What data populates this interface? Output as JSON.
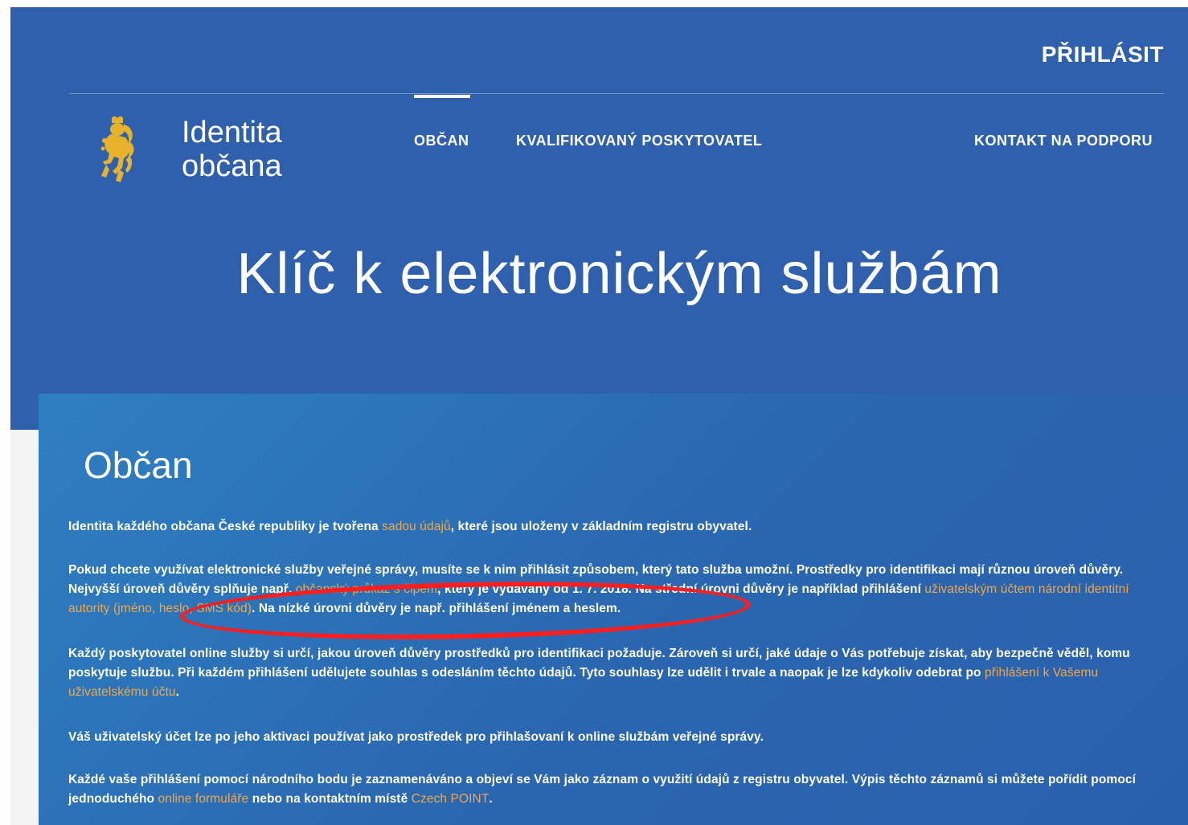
{
  "header": {
    "login_label": "PŘIHLÁSIT",
    "logo_line1": "Identita",
    "logo_line2": "občana",
    "nav": [
      {
        "label": "OBČAN",
        "active": true
      },
      {
        "label": "KVALIFIKOVANÝ POSKYTOVATEL",
        "active": false
      },
      {
        "label": "KONTAKT NA PODPORU",
        "active": false
      }
    ]
  },
  "hero": {
    "title": "Klíč k elektronickým službám"
  },
  "section": {
    "title": "Občan",
    "p1": {
      "before": "Identita každého občana České republiky je tvořena ",
      "link": "sadou údajů",
      "after": ", které jsou uloženy v základním registru obyvatel."
    },
    "p2": {
      "before": "Pokud chcete využívat elektronické služby veřejné správy, musíte se k nim přihlásit způsobem, který tato služba umožní. Prostředky pro identifikaci mají různou úroveň důvěry. Nejvyšší úroveň důvěry splňuje např. ",
      "link1": "občanský průkaz s čipem",
      "middle": ", který je vydávaný od 1. 7. 2018. Na střední úrovni důvěry je například přihlášení ",
      "link2": "uživatelským účtem národní identitní autority (jméno, heslo, SMS kód)",
      "after": ". Na nízké úrovni důvěry je např. přihlášení jménem a heslem."
    },
    "p3": {
      "before": "Každý poskytovatel online služby si určí, jakou úroveň důvěry prostředků pro identifikaci požaduje. Zároveň si určí, jaké údaje o Vás potřebuje získat, aby bezpečně věděl, komu poskytuje službu. Při každém přihlášení udělujete souhlas s odesláním těchto údajů. Tyto souhlasy lze udělit i trvale a naopak je lze kdykoliv odebrat po ",
      "link": "přihlášení k Vašemu uživatelskému účtu",
      "after": "."
    },
    "p4": "Váš uživatelský účet lze po jeho aktivaci používat jako prostředek pro přihlašovaní k online službám veřejné správy.",
    "p5": {
      "before": "Každé vaše přihlášení pomocí národního bodu je zaznamenáváno a objeví se Vám jako záznam o využití údajů z registru obyvatel. Výpis těchto záznamů si můžete pořídit pomocí jednoduchého ",
      "link1": "online formuláře",
      "middle": " nebo na kontaktním místě ",
      "link2": "Czech POINT",
      "after": "."
    }
  },
  "colors": {
    "hero_bg": "#2f60ae",
    "panel_bg": "#2a66b0",
    "link": "#f0a847",
    "logo_gold": "#e8b32a",
    "annotation": "#ff1e1e"
  },
  "icons": {
    "logo": "czech-lion-emblem-icon"
  }
}
